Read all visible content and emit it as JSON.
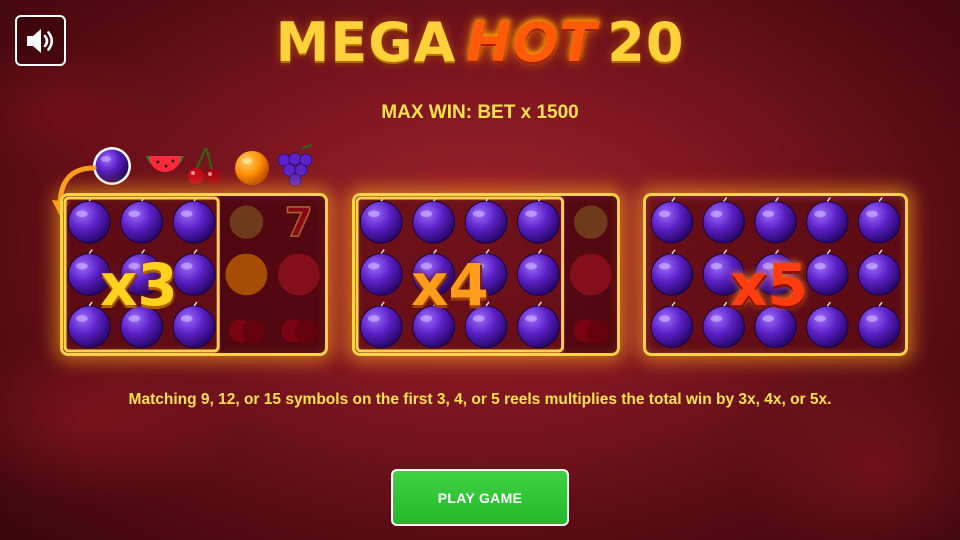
{
  "header": {
    "title_part1": "MEGA",
    "title_part2": "HOT",
    "title_part3": "20",
    "max_win": "MAX WIN: BET x 1500"
  },
  "sound_button": {
    "icon": "speaker-icon"
  },
  "fruit_row": [
    "plum",
    "watermelon",
    "cherries",
    "orange",
    "grapes"
  ],
  "panels": [
    {
      "multiplier": "x3",
      "matched_reels": 3,
      "color": "#ffd21e"
    },
    {
      "multiplier": "x4",
      "matched_reels": 4,
      "color": "#ff9c1a"
    },
    {
      "multiplier": "x5",
      "matched_reels": 5,
      "color": "#ff3b10"
    }
  ],
  "description": "Matching 9, 12, or 15 symbols on the first 3, 4, or 5 reels multiplies the total win by 3x, 4x, or 5x.",
  "play_button": {
    "label": "PLAY GAME",
    "color": "#25b82b"
  },
  "colors": {
    "accent_text": "#ffe24a",
    "frame": "#ffd24a",
    "background": "#7e1620"
  }
}
